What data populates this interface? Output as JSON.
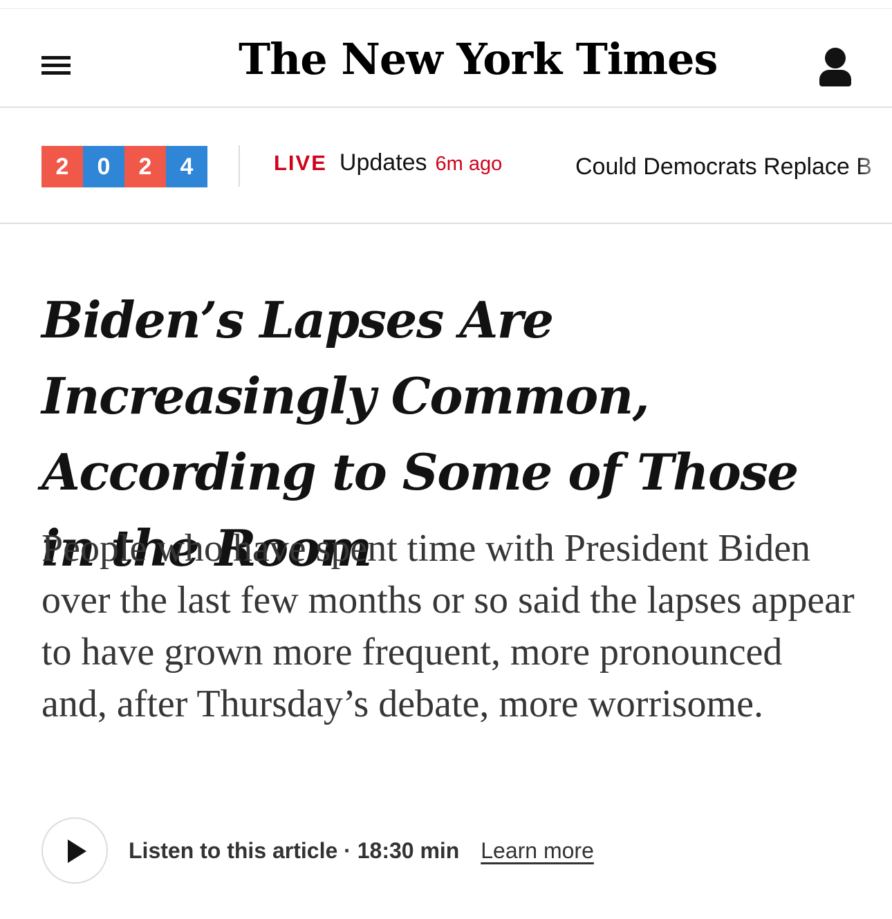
{
  "header": {
    "logo_text": "The New York Times",
    "menu_icon": "hamburger-menu-icon",
    "account_icon": "user-account-icon"
  },
  "ticker": {
    "year_digits": [
      "2",
      "0",
      "2",
      "4"
    ],
    "year_colors": [
      "#f0584a",
      "#2f86d6",
      "#f0584a",
      "#2f86d6"
    ],
    "live_label": "LIVE",
    "live_text": "Updates",
    "live_time": "6m ago",
    "story_text": "Could Democrats Replace B"
  },
  "article": {
    "headline": "Biden’s Lapses Are Increasingly Common, According to Some of Those in the Room",
    "summary": "People who have spent time with President Biden over the last few months or so said the lapses appear to have grown more frequent, more pronounced and, after Thursday’s debate, more worrisome."
  },
  "audio": {
    "play_icon": "play-icon",
    "label": "Listen to this article · 18:30 min",
    "learn_more": "Learn more"
  },
  "colors": {
    "live_red": "#d0021b",
    "text": "#121212",
    "summary_text": "#363636"
  }
}
